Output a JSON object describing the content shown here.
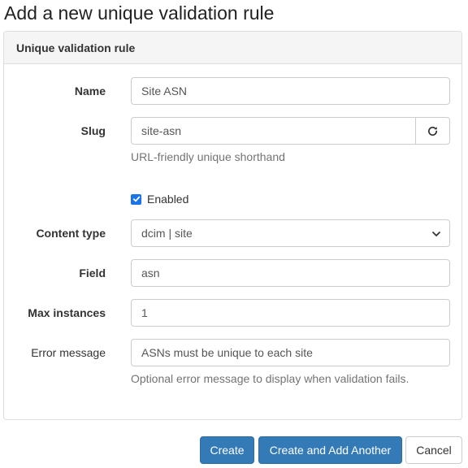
{
  "page": {
    "title": "Add a new unique validation rule"
  },
  "panel": {
    "heading": "Unique validation rule"
  },
  "form": {
    "name": {
      "label": "Name",
      "value": "Site ASN"
    },
    "slug": {
      "label": "Slug",
      "value": "site-asn",
      "help": "URL-friendly unique shorthand",
      "regenerate_icon": "refresh-icon"
    },
    "enabled": {
      "label": "Enabled",
      "checked": true
    },
    "content_type": {
      "label": "Content type",
      "value": "dcim | site"
    },
    "field": {
      "label": "Field",
      "value": "asn"
    },
    "max_instances": {
      "label": "Max instances",
      "value": "1"
    },
    "error_message": {
      "label": "Error message",
      "value": "ASNs must be unique to each site",
      "help": "Optional error message to display when validation fails."
    }
  },
  "actions": {
    "create_label": "Create",
    "create_another_label": "Create and Add Another",
    "cancel_label": "Cancel"
  },
  "colors": {
    "primary": "#337ab7",
    "checkbox": "#1a73e8"
  }
}
